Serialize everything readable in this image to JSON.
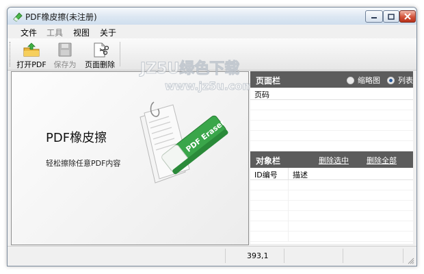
{
  "window": {
    "title": "PDF橡皮擦(未注册)"
  },
  "menu": {
    "items": [
      "文件",
      "工具",
      "视图",
      "关于"
    ]
  },
  "toolbar": {
    "open_label": "打开PDF",
    "save_label": "保存为",
    "delete_page_label": "页面删除"
  },
  "splash": {
    "app_name": "PDF橡皮擦",
    "tagline": "轻松擦除任意PDF内容",
    "eraser_text": "PDF Eraser"
  },
  "watermark": {
    "line1": "JZ5U绿色下载",
    "line2": "www.jz5u.com"
  },
  "page_panel": {
    "title": "页面栏",
    "view_options": [
      {
        "label": "缩略图",
        "selected": false
      },
      {
        "label": "列表",
        "selected": true
      }
    ],
    "column": "页码"
  },
  "object_panel": {
    "title": "对象栏",
    "delete_selected": "删除选中",
    "delete_all": "删除全部",
    "columns": [
      "ID编号",
      "描述"
    ]
  },
  "status": {
    "coords": "393,1"
  },
  "colors": {
    "panel_header": "#5c5c5c",
    "accent": "#3aa64a"
  }
}
